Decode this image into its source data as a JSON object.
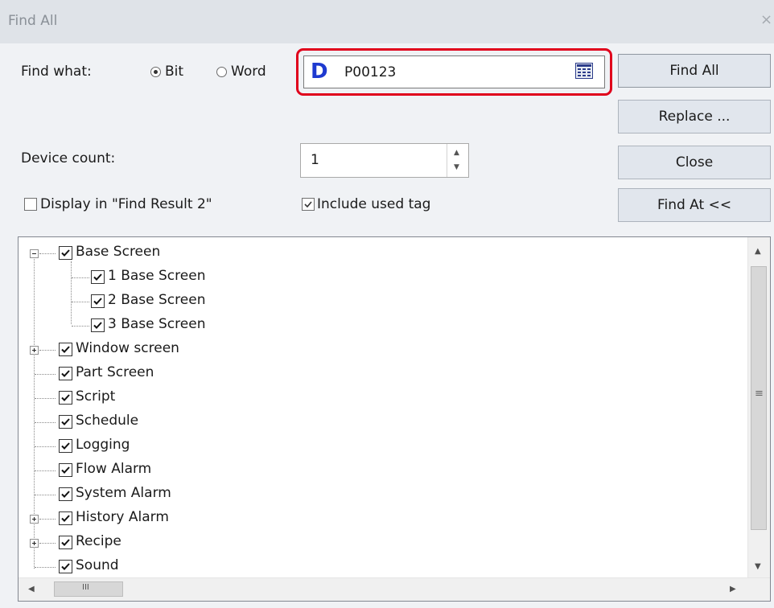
{
  "dialog": {
    "title": "Find All",
    "close_glyph": "×"
  },
  "find_what": {
    "label": "Find what:",
    "bit_label": "Bit",
    "word_label": "Word",
    "selected": "Bit",
    "device_prefix": "D",
    "value": "P00123",
    "highlight_color": "#e0001b"
  },
  "device_count": {
    "label": "Device count:",
    "value": "1"
  },
  "options": {
    "display_in_label": "Display in \"Find Result 2\"",
    "display_in_checked": false,
    "include_used_tag_label": "Include used tag",
    "include_used_tag_checked": true
  },
  "buttons": {
    "find_all": "Find All",
    "replace": "Replace ...",
    "close": "Close",
    "find_at": "Find At <<"
  },
  "tree": {
    "items": [
      {
        "label": "Base Screen",
        "checked": true,
        "expander": "minus"
      },
      {
        "label": "1 Base Screen",
        "checked": true
      },
      {
        "label": "2 Base Screen",
        "checked": true
      },
      {
        "label": "3 Base Screen",
        "checked": true
      },
      {
        "label": "Window screen",
        "checked": true,
        "expander": "plus"
      },
      {
        "label": "Part Screen",
        "checked": true
      },
      {
        "label": "Script",
        "checked": true
      },
      {
        "label": "Schedule",
        "checked": true
      },
      {
        "label": "Logging",
        "checked": true
      },
      {
        "label": "Flow Alarm",
        "checked": true
      },
      {
        "label": "System Alarm",
        "checked": true
      },
      {
        "label": "History Alarm",
        "checked": true,
        "expander": "plus"
      },
      {
        "label": "Recipe",
        "checked": true,
        "expander": "plus"
      },
      {
        "label": "Sound",
        "checked": true
      }
    ],
    "scroll_grip": "≡",
    "hscroll_grip": "III"
  }
}
